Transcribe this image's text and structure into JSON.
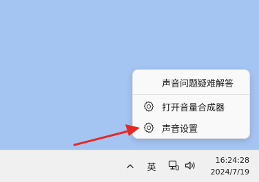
{
  "menu": {
    "items": [
      {
        "label": "声音问题疑难解答",
        "icon": "none"
      },
      {
        "label": "打开音量合成器",
        "icon": "gear-icon"
      },
      {
        "label": "声音设置",
        "icon": "gear-icon"
      }
    ]
  },
  "taskbar": {
    "chevron_icon": "chevron-up-icon",
    "ime_label": "英",
    "network_icon": "ethernet-icon",
    "volume_icon": "speaker-icon",
    "time": "16:24:28",
    "date": "2024/7/19"
  },
  "annotation": {
    "arrow_color": "#e8281f"
  },
  "colors": {
    "desktop_bg": "#a4c4f2",
    "menu_bg": "#f9f9f9",
    "taskbar_bg": "#f0f0f0"
  }
}
